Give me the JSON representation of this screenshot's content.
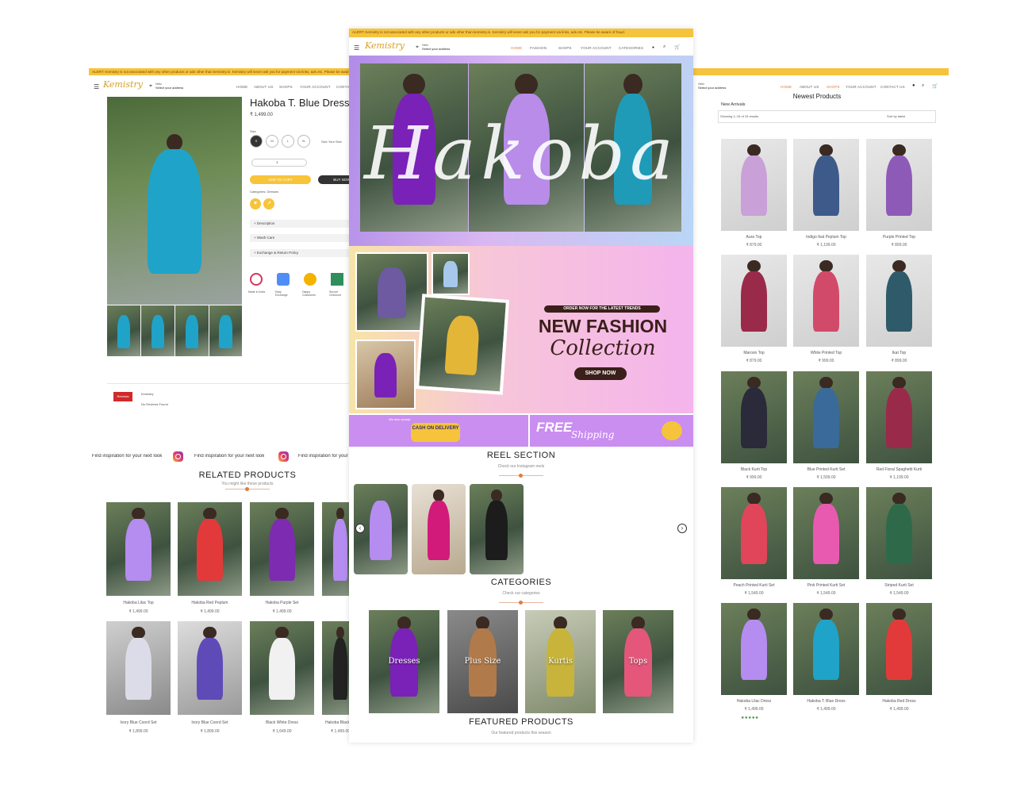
{
  "left_page": {
    "alert": "ALERT: Kemistry is not associated with any other products or ads other than kemistry.in. Kemistry will never ask you for payment via links, ads etc. Please be aware of fraud.",
    "logo": "Kemistry",
    "location_top": "Hello",
    "location_bottom": "Select your address",
    "nav": [
      "HOME",
      "ABOUT US",
      "SHOPS",
      "YOUR ACCOUNT",
      "CONTACT"
    ],
    "product_title": "Hakoba T. Blue Dress",
    "price": "₹ 1,499.00",
    "size_label": "Size",
    "sizes": [
      "S",
      "M",
      "L",
      "XL"
    ],
    "size_guide": "Size Your Size",
    "qty": "1",
    "add_to_cart": "ADD TO CART",
    "buy_now": "BUY NOW",
    "tags_line": "Categories: Dresses",
    "accordion": [
      "+ Description",
      "+ Wash Care",
      "+ Exchange & Return Policy"
    ],
    "badges": [
      "Made in India",
      "Easy Exchange",
      "Happy Customers",
      "Secure Checkout"
    ],
    "review_btn": "Reviews",
    "review_title": "Kemistry",
    "review_text": "No Reviews Found",
    "insta_banner": "Find inspiration for your next look",
    "related_title": "RELATED PRODUCTS",
    "related_sub": "You might like these products",
    "related_row1": [
      {
        "name": "Hakoba Lilac Top",
        "price": "₹ 1,499.00"
      },
      {
        "name": "Hakoba Red Peplum",
        "price": "₹ 1,499.00"
      },
      {
        "name": "Hakoba Purple Set",
        "price": "₹ 1,499.00"
      }
    ],
    "related_row2": [
      {
        "name": "Ivory Blue Coord Set",
        "price": "₹ 1,899.00"
      },
      {
        "name": "Ivory Blue Coord Set",
        "price": "₹ 1,899.00"
      },
      {
        "name": "Black White Dress",
        "price": "₹ 1,649.00"
      },
      {
        "name": "Hakoba Black",
        "price": "₹ 1,499.00"
      }
    ]
  },
  "center_page": {
    "alert": "ALERT: Kemistry is not associated with any other products or ads other than kemistry.in. Kemistry will never ask you for payment via links, ads etc. Please be aware of fraud.",
    "logo": "Kemistry",
    "location_top": "Hello",
    "location_bottom": "Select your address",
    "nav": [
      "HOME",
      "FASHION",
      "SHOPS",
      "YOUR ACCOUNT",
      "CATEGORIES"
    ],
    "hero_word": "Hakoba",
    "promo_kicker": "ORDER NOW FOR THE LATEST TRENDS",
    "promo_title": "NEW FASHION",
    "promo_script": "Collection",
    "promo_btn": "SHOP NOW",
    "cod_small": "We also accept",
    "cod_label": "CASH ON DELIVERY",
    "free_big": "FREE",
    "free_script": "Shipping",
    "reel_title": "REEL SECTION",
    "reel_sub": "Check our Instagram reels",
    "categories_title": "CATEGORIES",
    "categories_sub": "Check our categories",
    "categories": [
      "Dresses",
      "Plus Size",
      "Kurtis",
      "Tops"
    ],
    "featured_title": "FEATURED PRODUCTS",
    "featured_sub": "Our featured products this season"
  },
  "right_page": {
    "logo": "Kemistry",
    "location_top": "Hello",
    "location_bottom": "Select your address",
    "nav": [
      "HOME",
      "ABOUT US",
      "SHOPS",
      "YOUR ACCOUNT",
      "CONTACT US"
    ],
    "heading": "Newest Products",
    "breadcrumb": "New Arrivals",
    "filter_text": "Showing 1–15 of 15 results",
    "sort_text": "Sort by latest",
    "products": [
      {
        "name": "Aura Top",
        "price": "₹ 879.00"
      },
      {
        "name": "Indigo Ikat Peplum Top",
        "price": "₹ 1,199.00"
      },
      {
        "name": "Purple Printed Top",
        "price": "₹ 899.00"
      },
      {
        "name": "Maroon Top",
        "price": "₹ 879.00"
      },
      {
        "name": "White Printed Top",
        "price": "₹ 999.00"
      },
      {
        "name": "Ikat Top",
        "price": "₹ 899.00"
      },
      {
        "name": "Black Kurti Top",
        "price": "₹ 999.00"
      },
      {
        "name": "Blue Printed Kurti Set",
        "price": "₹ 1,599.00"
      },
      {
        "name": "Red Floral Spaghetti Kurti",
        "price": "₹ 1,199.00"
      },
      {
        "name": "Peach Printed Kurti Set",
        "price": "₹ 1,549.00"
      },
      {
        "name": "Pink Printed Kurti Set",
        "price": "₹ 1,549.00"
      },
      {
        "name": "Striped Kurti Set",
        "price": "₹ 1,549.00"
      },
      {
        "name": "Hakoba Lilac Dress",
        "price": "₹ 1,499.00"
      },
      {
        "name": "Hakoba T. Blue Dress",
        "price": "₹ 1,499.00"
      },
      {
        "name": "Hakoba Red Dress",
        "price": "₹ 1,499.00"
      }
    ],
    "rating_stars": "★★★★★"
  },
  "colors": {
    "alert_bg": "#f6c33d",
    "logo": "#d8a02a",
    "accent_orange": "#e07b3a",
    "promo_bg": "#f7b6e0",
    "cod_bar": "#c98ef0"
  }
}
